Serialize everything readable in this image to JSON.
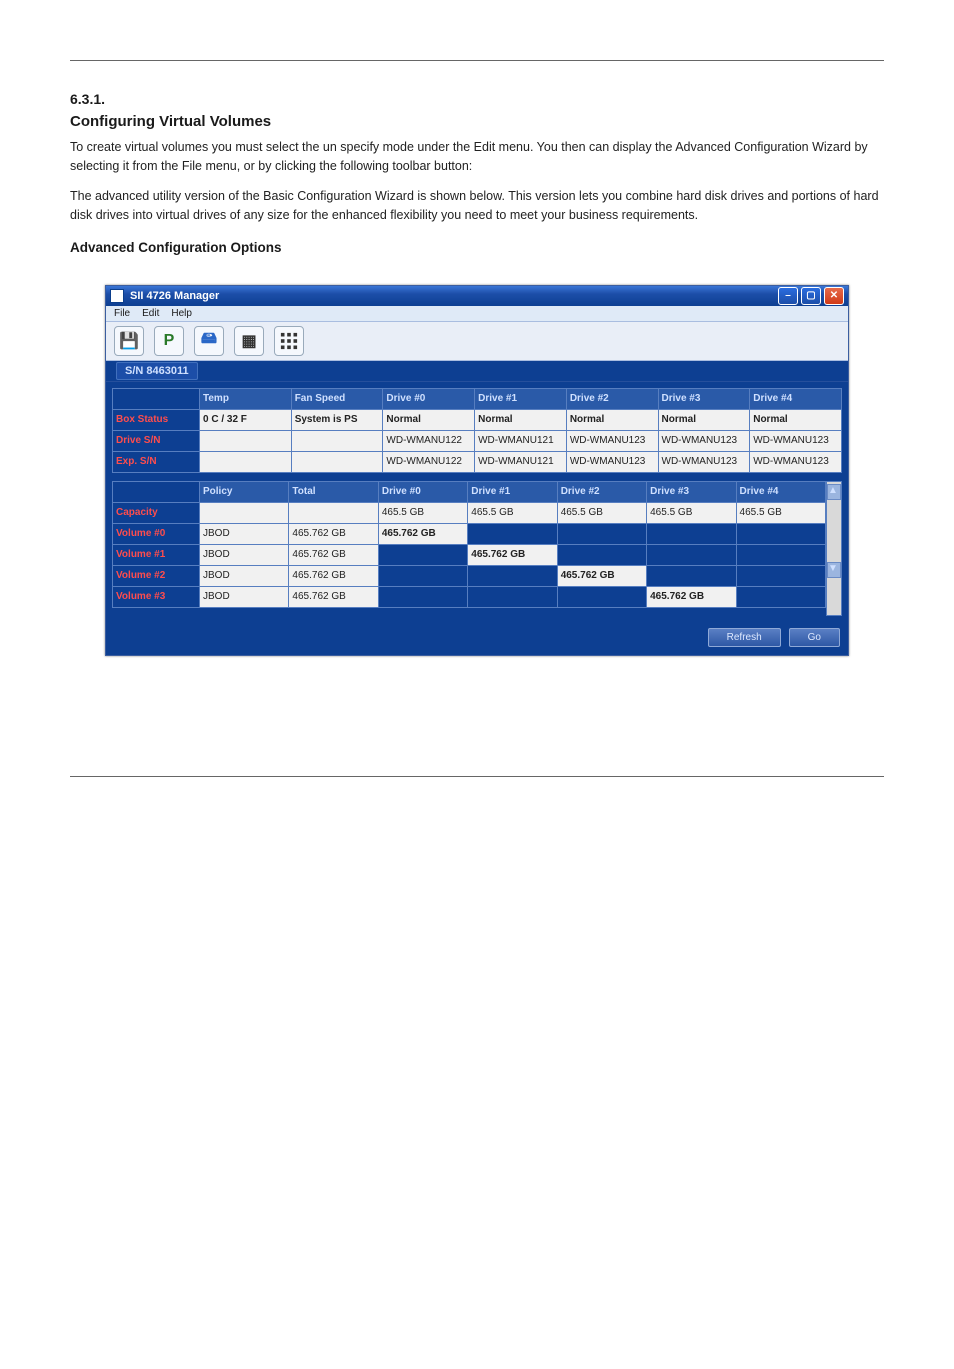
{
  "page": {
    "section_num": "6.3.1.",
    "section_title": "Configuring Virtual Volumes",
    "para1": "To create virtual volumes you must select the un specify mode under the Edit menu. You then can display the Advanced Configuration Wizard by selecting it from the File menu, or by clicking the following toolbar button:",
    "para2": "The advanced utility version of the Basic Configuration Wizard is shown below. This version lets you combine hard disk drives and portions of hard disk drives into virtual drives of any size for the enhanced flexibility you need to meet your business requirements.",
    "subhead": "Advanced Configuration Options"
  },
  "window": {
    "title": "SII 4726 Manager",
    "menus": [
      "File",
      "Edit",
      "Help"
    ],
    "sn_tab": "S/N 8463011",
    "table1": {
      "cols": [
        "Temp",
        "Fan Speed",
        "Drive #0",
        "Drive #1",
        "Drive #2",
        "Drive #3",
        "Drive #4"
      ],
      "rows": [
        {
          "h": "Box Status",
          "cells": [
            "0 C / 32 F",
            "System is PS",
            "Normal",
            "Normal",
            "Normal",
            "Normal",
            "Normal"
          ],
          "style": [
            "orange",
            "orange",
            "green",
            "green",
            "green",
            "green",
            "green"
          ]
        },
        {
          "h": "Drive S/N",
          "cells": [
            "",
            "",
            "WD-WMANU122",
            "WD-WMANU121",
            "WD-WMANU123",
            "WD-WMANU123",
            "WD-WMANU123"
          ]
        },
        {
          "h": "Exp.  S/N",
          "cells": [
            "",
            "",
            "WD-WMANU122",
            "WD-WMANU121",
            "WD-WMANU123",
            "WD-WMANU123",
            "WD-WMANU123"
          ]
        }
      ]
    },
    "table2": {
      "cols": [
        "Policy",
        "Total",
        "Drive #0",
        "Drive #1",
        "Drive #2",
        "Drive #3",
        "Drive #4"
      ],
      "rows": [
        {
          "h": "Capacity",
          "cells": [
            "",
            "",
            "465.5 GB",
            "465.5 GB",
            "465.5 GB",
            "465.5 GB",
            "465.5 GB"
          ]
        },
        {
          "h": "Volume #0",
          "cells": [
            "JBOD",
            "465.762 GB",
            "465.762 GB",
            "",
            "",
            "",
            ""
          ],
          "sel": 2
        },
        {
          "h": "Volume #1",
          "cells": [
            "JBOD",
            "465.762 GB",
            "",
            "465.762 GB",
            "",
            "",
            ""
          ],
          "sel": 3
        },
        {
          "h": "Volume #2",
          "cells": [
            "JBOD",
            "465.762 GB",
            "",
            "",
            "465.762 GB",
            "",
            ""
          ],
          "sel": 4
        },
        {
          "h": "Volume #3",
          "cells": [
            "JBOD",
            "465.762 GB",
            "",
            "",
            "",
            "465.762 GB",
            ""
          ],
          "sel": 5
        }
      ]
    },
    "buttons": {
      "refresh": "Refresh",
      "go": "Go"
    }
  }
}
